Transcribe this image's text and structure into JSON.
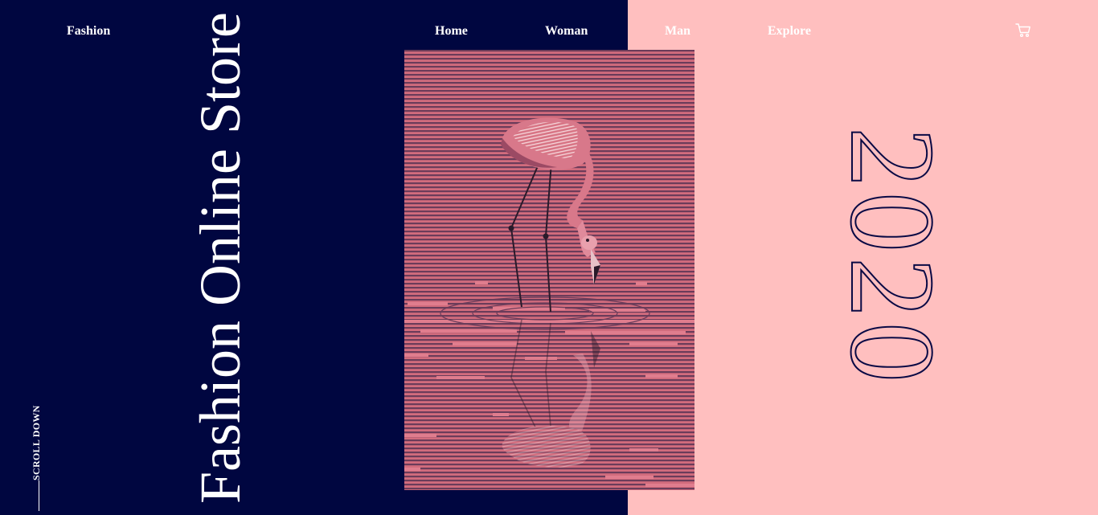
{
  "colors": {
    "navy": "#000640",
    "pink": "#ffbfbf",
    "art_bg": "#d26c7d",
    "stripe": "#6b3c5a"
  },
  "nav": {
    "brand": "Fashion",
    "links": [
      "Home",
      "Woman",
      "Man",
      "Explore"
    ],
    "cart_icon": "cart-icon"
  },
  "hero": {
    "title": "Fashion Online Store"
  },
  "scroll": {
    "label": "SCROLL DOWN"
  },
  "year": {
    "text": "2020"
  },
  "artwork": {
    "subject": "flamingo-illustration"
  }
}
